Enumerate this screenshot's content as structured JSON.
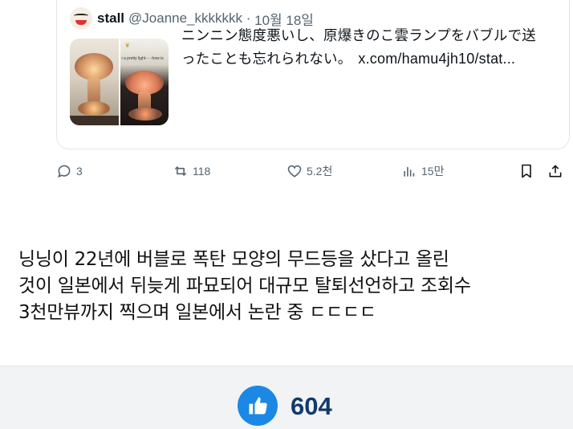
{
  "tweet": {
    "display_name": "stall",
    "handle": "@Joanne_kkkkkkk",
    "separator": "·",
    "date": "10월 18일",
    "media_caption": "i a pretty light·····how is",
    "text_line1": "ニンニン態度悪いし、原爆きのこ雲ランプをバブルで送",
    "text_line2": "ったことも忘れられない。",
    "link": "x.com/hamu4jh10/stat..."
  },
  "actions": {
    "replies": "3",
    "reposts": "118",
    "likes": "5.2천",
    "views": "15만"
  },
  "post": {
    "line1": "닝닝이 22년에 버블로 폭탄 모양의 무드등을 샀다고 올린",
    "line2": "것이 일본에서 뒤늦게 파묘되어 대규모 탈퇴선언하고 조회수",
    "line3": "3천만뷰까지 찍으며 일본에서 논란 중 ㄷㄷㄷㄷ"
  },
  "footer": {
    "like_count": "604"
  },
  "icons": {
    "reply": "reply-icon",
    "repost": "repost-icon",
    "like": "heart-icon",
    "views": "views-icon",
    "bookmark": "bookmark-icon",
    "share": "share-icon",
    "thumbs_up": "thumbs-up-icon"
  },
  "colors": {
    "like_button": "#1c88e5",
    "like_count": "#123a6b",
    "icon_gray": "#536471"
  }
}
